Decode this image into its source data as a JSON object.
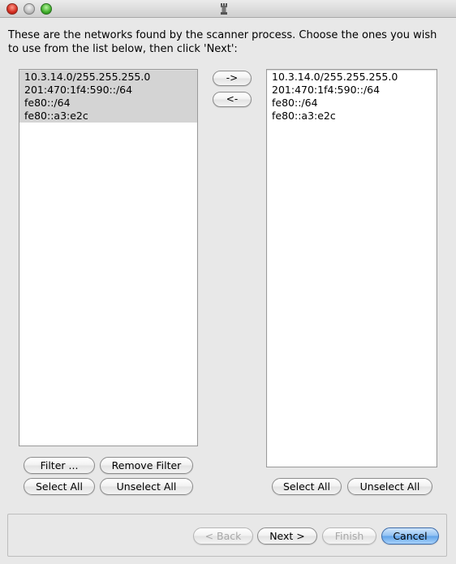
{
  "window": {
    "title_icon": "rook-icon"
  },
  "instructions": "These are the networks found by the scanner process. Choose the ones you wish to use from the list below, then click 'Next':",
  "left_list": {
    "items": [
      "10.3.14.0/255.255.255.0",
      "201:470:1f4:590::/64",
      "fe80::/64",
      "fe80::a3:e2c"
    ]
  },
  "right_list": {
    "items": [
      "10.3.14.0/255.255.255.0",
      "201:470:1f4:590::/64",
      "fe80::/64",
      "fe80::a3:e2c"
    ]
  },
  "transfer": {
    "add_label": "->",
    "remove_label": "<-"
  },
  "left_buttons": {
    "filter": "Filter ...",
    "remove_filter": "Remove Filter",
    "select_all": "Select All",
    "unselect_all": "Unselect All"
  },
  "right_buttons": {
    "select_all": "Select All",
    "unselect_all": "Unselect All"
  },
  "wizard_buttons": {
    "back": "< Back",
    "next": "Next >",
    "finish": "Finish",
    "cancel": "Cancel"
  },
  "colors": {
    "selection": "#d4d4d4",
    "default_button": "#5fa2e8"
  }
}
